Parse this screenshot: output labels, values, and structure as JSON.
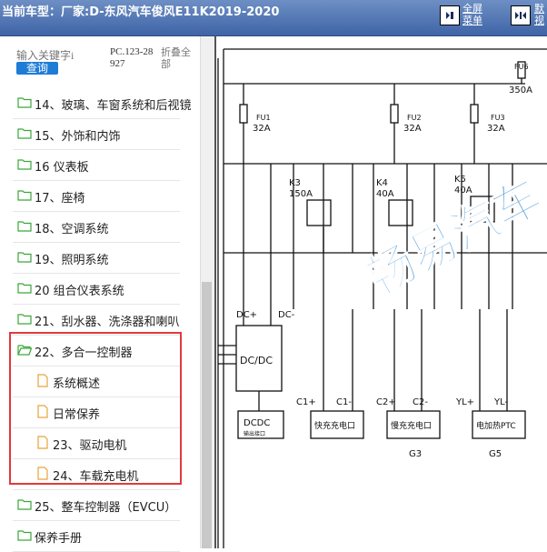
{
  "header": {
    "title": "当前车型：厂家:D-东风汽车俊风E11K2019-2020",
    "fullscreen_label_1": "全屏",
    "fullscreen_label_2": "菜单",
    "default_label_1": "默",
    "default_label_2": "视"
  },
  "sidebar": {
    "search": {
      "placeholder": "输入关键字i",
      "button_label": "查询"
    },
    "pc_code": "PC.123-28927",
    "fold_all_label": "折叠全部",
    "items": [
      {
        "type": "folder",
        "label": "14、玻璃、车窗系统和后视镜"
      },
      {
        "type": "folder",
        "label": "15、外饰和内饰"
      },
      {
        "type": "folder",
        "label": "16 仪表板"
      },
      {
        "type": "folder",
        "label": "17、座椅"
      },
      {
        "type": "folder",
        "label": "18、空调系统"
      },
      {
        "type": "folder",
        "label": "19、照明系统"
      },
      {
        "type": "folder",
        "label": "20 组合仪表系统"
      },
      {
        "type": "folder",
        "label": "21、刮水器、洗涤器和喇叭"
      },
      {
        "type": "folder-open",
        "label": "22、多合一控制器"
      },
      {
        "type": "doc",
        "label": "系统概述"
      },
      {
        "type": "doc",
        "label": "日常保养"
      },
      {
        "type": "doc",
        "label": "23、驱动电机"
      },
      {
        "type": "doc",
        "label": "24、车载充电机"
      },
      {
        "type": "folder",
        "label": "25、整车控制器（EVCU）"
      },
      {
        "type": "folder",
        "label": "保养手册"
      }
    ]
  },
  "diagram": {
    "fuses": [
      {
        "name": "FU1",
        "rating": "32A"
      },
      {
        "name": "FU2",
        "rating": "32A"
      },
      {
        "name": "FU3",
        "rating": "32A"
      },
      {
        "name": "FU6",
        "rating": "350A"
      }
    ],
    "relays": [
      {
        "name": "K3",
        "rating": "150A"
      },
      {
        "name": "K4",
        "rating": "40A"
      },
      {
        "name": "K5",
        "rating": "40A"
      }
    ],
    "terminals": [
      "DC+",
      "DC-",
      "C1+",
      "C1-",
      "C2+",
      "C2-",
      "YL+",
      "YL-"
    ],
    "blocks": [
      "DC/DC",
      "DCDC",
      "快充充电口",
      "慢充充电口",
      "电加热PTC"
    ],
    "block_sublabel": "输出接口",
    "groups": [
      "G3",
      "G5"
    ],
    "watermark": "畅易汽车"
  },
  "colors": {
    "header_bg": "#4a6fae",
    "search_button": "#1e7cd6",
    "highlight_border": "#e03a3a",
    "folder_icon": "#3aa63a",
    "doc_icon": "#e8a33d",
    "watermark": "#3a8fd8"
  }
}
